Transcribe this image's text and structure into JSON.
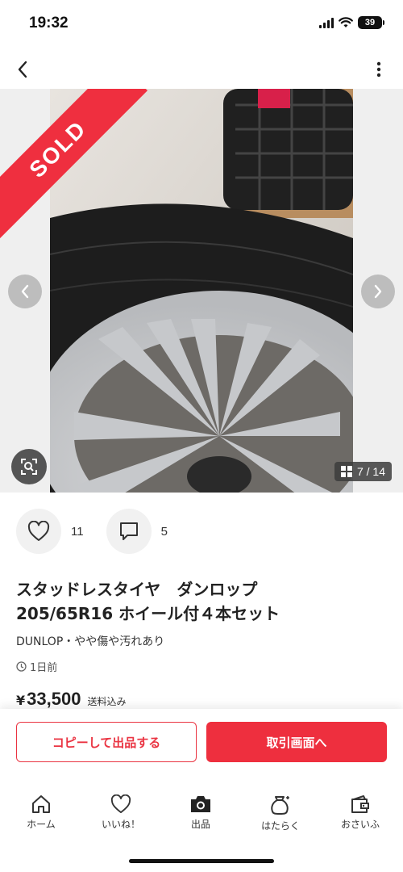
{
  "status_bar": {
    "time": "19:32",
    "battery": "39"
  },
  "gallery": {
    "sold_label": "SOLD",
    "counter": "7 / 14"
  },
  "actions": {
    "likes_count": "11",
    "comments_count": "5"
  },
  "item": {
    "title_line1": "スタッドレスタイヤ　ダンロップ",
    "title_line2": "205/65R16 ホイール付４本セット",
    "subtitle": "DUNLOP・やや傷や汚れあり",
    "posted": "1日前",
    "price_currency": "¥",
    "price_amount": "33,500",
    "price_note": "送料込み"
  },
  "cta": {
    "copy_label": "コピーして出品する",
    "trade_label": "取引画面へ"
  },
  "tabs": [
    {
      "label": "ホーム",
      "icon": "home-icon"
    },
    {
      "label": "いいね！",
      "icon": "heart-icon"
    },
    {
      "label": "出品",
      "icon": "camera-icon"
    },
    {
      "label": "はたらく",
      "icon": "money-bag-icon"
    },
    {
      "label": "おさいふ",
      "icon": "wallet-icon"
    }
  ],
  "colors": {
    "accent": "#ee2f3e",
    "sold": "#ef2f3f"
  }
}
